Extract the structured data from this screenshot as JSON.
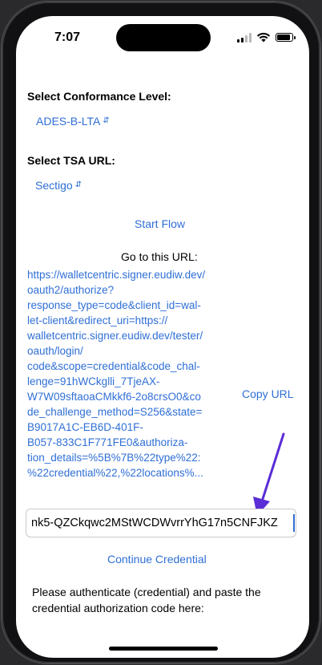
{
  "status_bar": {
    "time": "7:07"
  },
  "conformance": {
    "label": "Select Conformance Level:",
    "selected": "ADES-B-LTA"
  },
  "tsa": {
    "label": "Select TSA URL:",
    "selected": "Sectigo"
  },
  "actions": {
    "start_flow": "Start Flow",
    "copy_url": "Copy URL",
    "continue_credential": "Continue Credential"
  },
  "instructions": {
    "go_to_url": "Go to this URL:",
    "authenticate": "Please authenticate (credential) and paste the credential authorization code here:"
  },
  "url": {
    "text": "https://walletcentric.signer.eudiw.dev/\noauth2/authorize?\nresponse_type=code&client_id=wal-\nlet-client&redirect_uri=https://\nwalletcentric.signer.eudiw.dev/tester/\noauth/login/\ncode&scope=credential&code_chal-\nlenge=91hWCkglli_7TjeAX-\nW7W09sftaoaCMkkf6-2o8crsO0&co\nde_challenge_method=S256&state=\nB9017A1C-EB6D-401F-\nB057-833C1F771FE0&authoriza-\ntion_details=%5B%7B%22type%22:\n%22credential%22,%22locations%..."
  },
  "auth_code": {
    "value": "nk5-QZCkqwc2MStWCDWvrrYhG17n5CNFJKZ"
  },
  "colors": {
    "accent": "#2f6fd6",
    "annotation_arrow": "#5b2dd6"
  }
}
